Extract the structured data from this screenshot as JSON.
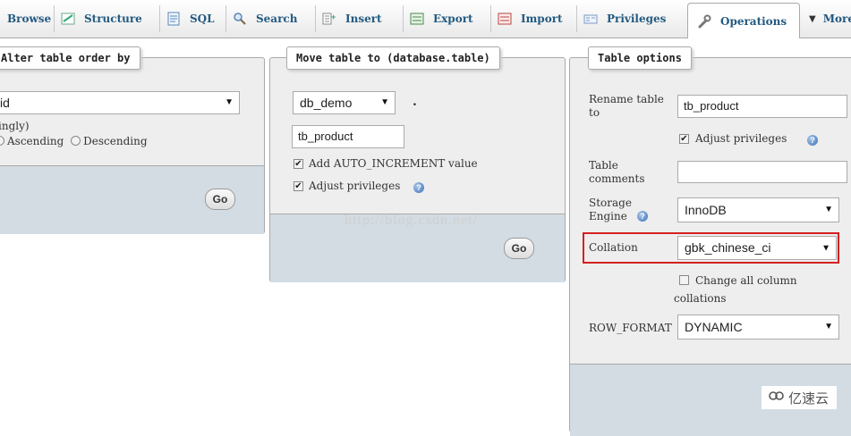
{
  "tabs": [
    {
      "label": "Browse",
      "icon": "browse-icon"
    },
    {
      "label": "Structure",
      "icon": "structure-icon"
    },
    {
      "label": "SQL",
      "icon": "sql-icon"
    },
    {
      "label": "Search",
      "icon": "search-icon"
    },
    {
      "label": "Insert",
      "icon": "insert-icon"
    },
    {
      "label": "Export",
      "icon": "export-icon"
    },
    {
      "label": "Import",
      "icon": "import-icon"
    },
    {
      "label": "Privileges",
      "icon": "privileges-icon"
    },
    {
      "label": "Operations",
      "icon": "wrench-icon",
      "active": true
    },
    {
      "label": "More",
      "icon": "chevron-down-icon"
    }
  ],
  "alter_order": {
    "legend": "Alter table order by",
    "column_value": "id",
    "order_hint": "ingly)",
    "ascending_label": "Ascending",
    "descending_label": "Descending",
    "go_label": "Go"
  },
  "move_table": {
    "legend": "Move table to (database.table)",
    "database_value": "db_demo",
    "dot": ".",
    "table_value": "tb_product",
    "auto_increment_label": "Add AUTO_INCREMENT value",
    "adjust_privileges_label": "Adjust privileges",
    "go_label": "Go"
  },
  "table_options": {
    "legend": "Table options",
    "rename_label": "Rename table to",
    "rename_value": "tb_product",
    "adjust_privileges_label": "Adjust privileges",
    "comments_label": "Table comments",
    "comments_value": "",
    "engine_label": "Storage Engine",
    "engine_value": "InnoDB",
    "collation_label": "Collation",
    "collation_value": "gbk_chinese_ci",
    "change_all_line1": "Change all column",
    "change_all_line2": "collations",
    "row_format_label": "ROW_FORMAT",
    "row_format_value": "DYNAMIC"
  },
  "watermark": "http://blog.csdn.net/",
  "logo_text": "亿速云",
  "colors": {
    "tab_text": "#235a81",
    "highlight": "#d42020",
    "panel_bg": "#eeeeee",
    "footer_bg": "#d3dce3"
  }
}
